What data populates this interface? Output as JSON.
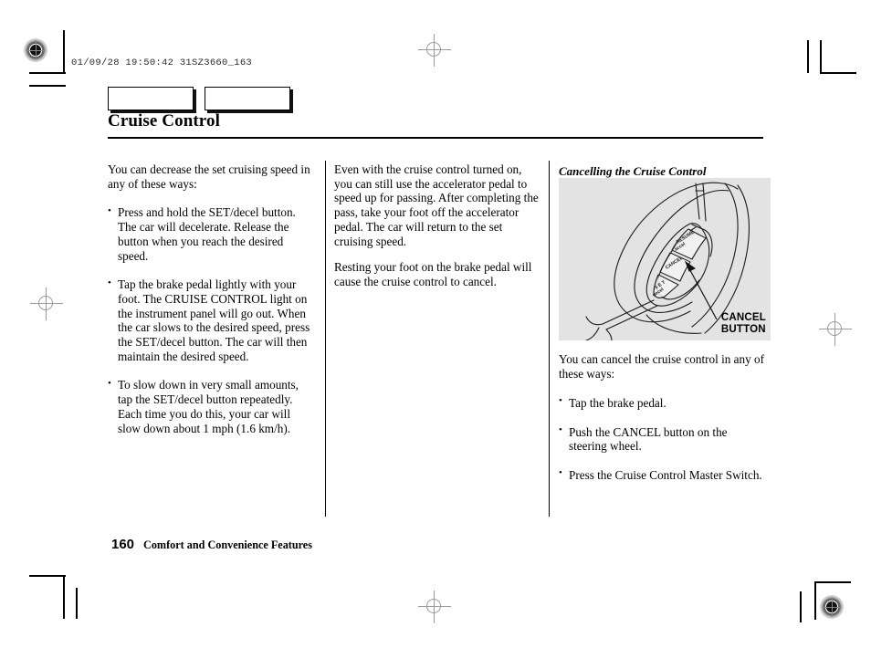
{
  "scan": {
    "header_stamp": "01/09/28 19:50:42 31SZ3660_163"
  },
  "page": {
    "title": "Cruise Control",
    "tabs": [
      {
        "label": ""
      },
      {
        "label": ""
      }
    ],
    "footer": {
      "page_number": "160",
      "section_title": "Comfort and Convenience Features"
    }
  },
  "columns": {
    "left": {
      "intro": "You can decrease the set cruising speed in any of these ways:",
      "bullets": [
        "Press and hold the SET/decel button. The car will decelerate. Release the button when you reach the desired speed.",
        "Tap the brake pedal lightly with your foot. The CRUISE CONTROL light on the instrument panel will go out. When the car slows to the desired speed, press the SET/decel button. The car will then maintain the desired speed.",
        "To slow down in very small amounts, tap the SET/decel button repeatedly. Each time you do this, your car will slow down about 1 mph (1.6 km/h)."
      ]
    },
    "middle": {
      "paragraphs": [
        "Even with the cruise control turned on, you can still use the accelerator pedal to speed up for passing. After completing the pass, take your foot off the accelerator pedal. The car will return to the set cruising speed.",
        "Resting your foot on the brake pedal will cause the cruise control to cancel."
      ]
    },
    "right": {
      "heading": "Cancelling the Cruise Control",
      "figure": {
        "caption_line1": "CANCEL",
        "caption_line2": "BUTTON",
        "background_color": "#e3e3e3",
        "switch_labels": [
          "RESUME/accel",
          "CANCEL",
          "SET/decel"
        ]
      },
      "intro": "You can cancel the cruise control in any of these ways:",
      "bullets": [
        "Tap the brake pedal.",
        "Push the CANCEL button on the steering wheel.",
        "Press the Cruise Control Master Switch."
      ]
    }
  }
}
